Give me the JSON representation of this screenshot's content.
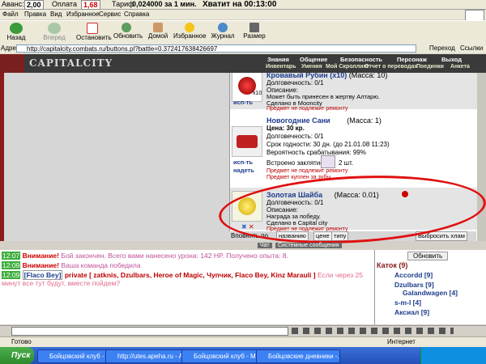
{
  "topbar": {
    "avans_label": "Аванс:",
    "avans_value": "2,00",
    "oplata_label": "Оплата",
    "oplata_value": "1,68",
    "tarif_label": "Тариф",
    "tarif_value": "0,024000 за 1 мин.",
    "enough_text": "Хватит на 00:13:00"
  },
  "menu": [
    "Файл",
    "Правка",
    "Вид",
    "Избранное",
    "Сервис",
    "Справка"
  ],
  "toolbar": {
    "back": "Назад",
    "forward": "Вперед",
    "stop": "Остановить",
    "refresh": "Обновить",
    "home": "Домой",
    "favorites": "Избранное",
    "history": "Журнал",
    "size": "Размер"
  },
  "address": {
    "label": "Адрес:",
    "url": "http://capitalcity.combats.ru/buttons.pl?battle=0.372417638426697",
    "go": "Переход",
    "links": "Ссылки"
  },
  "game": {
    "brand": "CAPITALCITY",
    "nav_top": [
      "Знания",
      "Общение",
      "Безопасность",
      "Персонаж",
      "Выход"
    ],
    "nav_bottom": [
      "Инвентарь",
      "Умения",
      "Мой Скроллинг",
      "Отчет о переводах",
      "Поединки",
      "Анкета"
    ]
  },
  "items": [
    {
      "name": "Кровавый Рубин (x10)",
      "mass": "(Масса: 10)",
      "count": "x10",
      "action": "исп-ть",
      "lines": [
        "Долговечность: 0/1",
        "Описание:",
        "Может быть принесен в жертву Алтарю.",
        "Сделано в Mooncity"
      ],
      "red": [
        "Предмет не подлежит ремонту"
      ]
    },
    {
      "name": "Новогодние Сани",
      "mass": "(Масса: 1)",
      "price": "Цена: 30 кр.",
      "action": "исп-ть",
      "action2": "надеть",
      "lines": [
        "Долговечность: 0/1",
        "Срок годности: 30 дн. (до 21.01.08 11:23)",
        "Вероятность срабатывания: 99%",
        "Встроено заклятие"
      ],
      "spell_count": "2 шт.",
      "red": [
        "Предмет не подлежит ремонту",
        "Предмет куплен за зубы"
      ]
    },
    {
      "name": "Золотая Шайба",
      "mass": "(Масса: 0.01)",
      "lines": [
        "Долговечность: 0/1",
        "Описание:",
        "Награда за победу.",
        "Сделано в Capital city"
      ],
      "red": [
        "Предмет не подлежит ремонту"
      ]
    }
  ],
  "sortbar": {
    "label": "Вповнять по",
    "by_name": "названию",
    "by_price": "цене",
    "by_type": "типу",
    "pick": "Выбросить хлам"
  },
  "chat_tabs": [
    "Чат",
    "Системные сообщения"
  ],
  "chat": [
    {
      "time": "12:07",
      "prefix": "Внимание!",
      "text": "Бой закончен. Всего вами нанесено урона: 142 HP. Получено опыта: 8."
    },
    {
      "time": "12:09",
      "prefix": "Внимание!",
      "text": "Ваша команда победила"
    },
    {
      "time": "12:09",
      "prefix": "[Flaco Bey]",
      "private": "private [ zatknis, Dzulbars, Heroe of Magic, Чупчик, Flaco Bey, Kinz Marauli ]",
      "text": "Если через 25 минут все тут будут, вместе пойдем?"
    }
  ],
  "users": {
    "refresh": "Обновить",
    "room": "Каток (9)",
    "list": [
      "Accordd [9]",
      "Dzulbars [9]",
      "Galandwagen [4]",
      "s-m-l [4]",
      "Аксиал [9]"
    ]
  },
  "status": {
    "ready": "Готово",
    "zone": "Интернет"
  },
  "taskbar": {
    "start": "Пуск",
    "tasks": [
      "Бойцовский клуб - Mi...",
      "http://utes.apeha.ru - A...",
      "Бойцовский клуб - Micr...",
      "Бойцовские дневники -..."
    ]
  }
}
